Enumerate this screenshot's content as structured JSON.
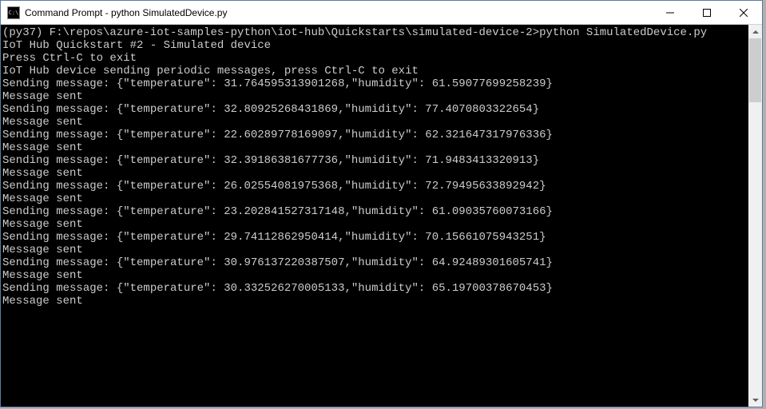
{
  "window": {
    "title": "Command Prompt - python  SimulatedDevice.py",
    "icon_text": "C:\\"
  },
  "terminal": {
    "prompt_line": "(py37) F:\\repos\\azure-iot-samples-python\\iot-hub\\Quickstarts\\simulated-device-2>python SimulatedDevice.py",
    "header1": "IoT Hub Quickstart #2 - Simulated device",
    "header2": "Press Ctrl-C to exit",
    "header3": "IoT Hub device sending periodic messages, press Ctrl-C to exit",
    "messages": [
      {
        "send": "Sending message: {\"temperature\": 31.764595313901268,\"humidity\": 61.59077699258239}",
        "sent": "Message sent"
      },
      {
        "send": "Sending message: {\"temperature\": 32.80925268431869,\"humidity\": 77.4070803322654}",
        "sent": "Message sent"
      },
      {
        "send": "Sending message: {\"temperature\": 22.60289778169097,\"humidity\": 62.321647317976336}",
        "sent": "Message sent"
      },
      {
        "send": "Sending message: {\"temperature\": 32.39186381677736,\"humidity\": 71.9483413320913}",
        "sent": "Message sent"
      },
      {
        "send": "Sending message: {\"temperature\": 26.02554081975368,\"humidity\": 72.79495633892942}",
        "sent": "Message sent"
      },
      {
        "send": "Sending message: {\"temperature\": 23.202841527317148,\"humidity\": 61.09035760073166}",
        "sent": "Message sent"
      },
      {
        "send": "Sending message: {\"temperature\": 29.74112862950414,\"humidity\": 70.15661075943251}",
        "sent": "Message sent"
      },
      {
        "send": "Sending message: {\"temperature\": 30.976137220387507,\"humidity\": 64.92489301605741}",
        "sent": "Message sent"
      },
      {
        "send": "Sending message: {\"temperature\": 30.332526270005133,\"humidity\": 65.19700378670453}",
        "sent": "Message sent"
      }
    ]
  }
}
